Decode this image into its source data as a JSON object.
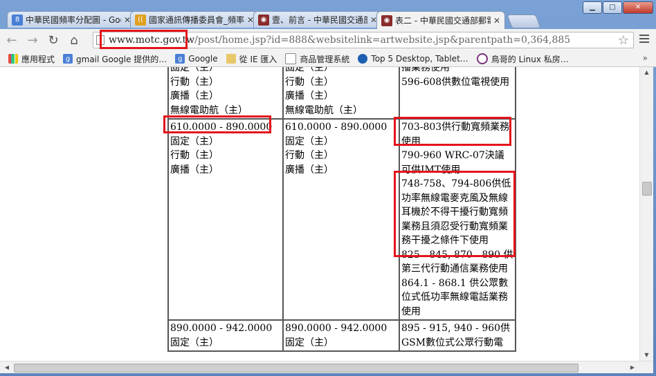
{
  "tabs": [
    {
      "title": "中華民國頻率分配圖 - Goo",
      "icon": "google-g-icon",
      "color": "#4a7fd6",
      "glyph": "8"
    },
    {
      "title": "國家通訊傳播委員會_頻率",
      "icon": "ncc-logo-icon",
      "color": "#e0a020",
      "glyph": "(("
    },
    {
      "title": "壹、前言 - 中華民國交通部",
      "icon": "motc-seal-icon",
      "color": "#8a2b2b",
      "glyph": "◉"
    },
    {
      "title": "表二 - 中華民國交通部郵電",
      "icon": "motc-seal-icon",
      "color": "#8a2b2b",
      "glyph": "◉"
    }
  ],
  "window": {
    "minimize": "▁",
    "maximize": "□",
    "close": "✕"
  },
  "address": {
    "domain": "www.motc.gov.tw",
    "rest": "/post/home.jsp?id=888&websitelink=artwebsite.jsp&parentpath=0,364,885"
  },
  "bookmarks": [
    {
      "label": "應用程式",
      "icon": "apps-grid-icon",
      "cls": "grid"
    },
    {
      "label": "gmail Google 提供的…",
      "icon": "google-g-icon",
      "cls": "g"
    },
    {
      "label": "Google",
      "icon": "google-g-icon",
      "cls": "g"
    },
    {
      "label": "從 IE 匯入",
      "icon": "folder-icon",
      "cls": "folder"
    },
    {
      "label": "商品管理系統",
      "icon": "page-icon",
      "cls": "page"
    },
    {
      "label": "Top 5 Desktop, Tablet…",
      "icon": "globe-icon",
      "cls": "globe"
    },
    {
      "label": "鳥哥的 Linux 私房…",
      "icon": "site-logo-icon",
      "cls": "round"
    }
  ],
  "bookmarks_more": "»",
  "table": {
    "rows": [
      {
        "c1": [
          "固定（主）",
          "行動（主）",
          "廣播（主）",
          "無線電助航（主）"
        ],
        "c2": [
          "固定（主）",
          "行動（主）",
          "廣播（主）",
          "無線電助航（主）"
        ],
        "c3": [
          "播業務使用",
          "596-608供數位電視使用"
        ]
      },
      {
        "c1": [
          "610.0000 - 890.0000",
          "固定（主）",
          "行動（主）",
          "廣播（主）"
        ],
        "c2": [
          "610.0000 - 890.0000",
          "固定（主）",
          "行動（主）",
          "廣播（主）"
        ],
        "c3": [
          "703-803供行動寬頻業務使用",
          "790-960 WRC-07決議可供IMT使用",
          "748-758、794-806供低功率無線電麥克風及無線耳機於不得干擾行動寬頻業務且須忍受行動寬頻業務干擾之條件下使用",
          "825 - 845, 870 - 890 供第三代行動通信業務使用",
          "864.1 - 868.1 供公眾數位式低功率無線電話業務使用"
        ]
      },
      {
        "c1": [
          "890.0000 - 942.0000",
          "固定（主）"
        ],
        "c2": [
          "890.0000 - 942.0000",
          "固定（主）"
        ],
        "c3": [
          "895 - 915, 940 - 960供GSM數位式公眾行動電"
        ]
      }
    ]
  },
  "colors": {
    "highlight": "#e4141b",
    "chrome_frame": "#6f8fbf"
  }
}
